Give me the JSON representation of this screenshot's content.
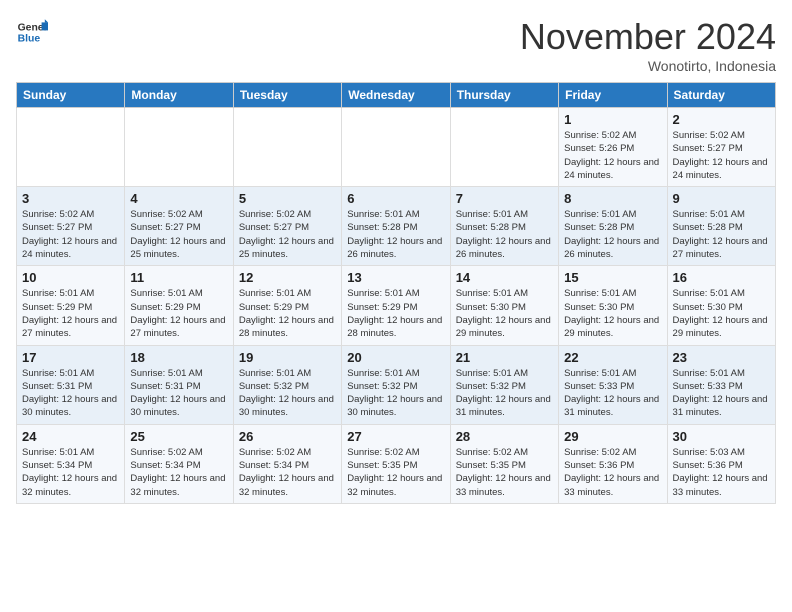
{
  "header": {
    "logo_line1": "General",
    "logo_line2": "Blue",
    "month": "November 2024",
    "location": "Wonotirto, Indonesia"
  },
  "days_of_week": [
    "Sunday",
    "Monday",
    "Tuesday",
    "Wednesday",
    "Thursday",
    "Friday",
    "Saturday"
  ],
  "weeks": [
    [
      {
        "day": "",
        "info": ""
      },
      {
        "day": "",
        "info": ""
      },
      {
        "day": "",
        "info": ""
      },
      {
        "day": "",
        "info": ""
      },
      {
        "day": "",
        "info": ""
      },
      {
        "day": "1",
        "info": "Sunrise: 5:02 AM\nSunset: 5:26 PM\nDaylight: 12 hours and 24 minutes."
      },
      {
        "day": "2",
        "info": "Sunrise: 5:02 AM\nSunset: 5:27 PM\nDaylight: 12 hours and 24 minutes."
      }
    ],
    [
      {
        "day": "3",
        "info": "Sunrise: 5:02 AM\nSunset: 5:27 PM\nDaylight: 12 hours and 24 minutes."
      },
      {
        "day": "4",
        "info": "Sunrise: 5:02 AM\nSunset: 5:27 PM\nDaylight: 12 hours and 25 minutes."
      },
      {
        "day": "5",
        "info": "Sunrise: 5:02 AM\nSunset: 5:27 PM\nDaylight: 12 hours and 25 minutes."
      },
      {
        "day": "6",
        "info": "Sunrise: 5:01 AM\nSunset: 5:28 PM\nDaylight: 12 hours and 26 minutes."
      },
      {
        "day": "7",
        "info": "Sunrise: 5:01 AM\nSunset: 5:28 PM\nDaylight: 12 hours and 26 minutes."
      },
      {
        "day": "8",
        "info": "Sunrise: 5:01 AM\nSunset: 5:28 PM\nDaylight: 12 hours and 26 minutes."
      },
      {
        "day": "9",
        "info": "Sunrise: 5:01 AM\nSunset: 5:28 PM\nDaylight: 12 hours and 27 minutes."
      }
    ],
    [
      {
        "day": "10",
        "info": "Sunrise: 5:01 AM\nSunset: 5:29 PM\nDaylight: 12 hours and 27 minutes."
      },
      {
        "day": "11",
        "info": "Sunrise: 5:01 AM\nSunset: 5:29 PM\nDaylight: 12 hours and 27 minutes."
      },
      {
        "day": "12",
        "info": "Sunrise: 5:01 AM\nSunset: 5:29 PM\nDaylight: 12 hours and 28 minutes."
      },
      {
        "day": "13",
        "info": "Sunrise: 5:01 AM\nSunset: 5:29 PM\nDaylight: 12 hours and 28 minutes."
      },
      {
        "day": "14",
        "info": "Sunrise: 5:01 AM\nSunset: 5:30 PM\nDaylight: 12 hours and 29 minutes."
      },
      {
        "day": "15",
        "info": "Sunrise: 5:01 AM\nSunset: 5:30 PM\nDaylight: 12 hours and 29 minutes."
      },
      {
        "day": "16",
        "info": "Sunrise: 5:01 AM\nSunset: 5:30 PM\nDaylight: 12 hours and 29 minutes."
      }
    ],
    [
      {
        "day": "17",
        "info": "Sunrise: 5:01 AM\nSunset: 5:31 PM\nDaylight: 12 hours and 30 minutes."
      },
      {
        "day": "18",
        "info": "Sunrise: 5:01 AM\nSunset: 5:31 PM\nDaylight: 12 hours and 30 minutes."
      },
      {
        "day": "19",
        "info": "Sunrise: 5:01 AM\nSunset: 5:32 PM\nDaylight: 12 hours and 30 minutes."
      },
      {
        "day": "20",
        "info": "Sunrise: 5:01 AM\nSunset: 5:32 PM\nDaylight: 12 hours and 30 minutes."
      },
      {
        "day": "21",
        "info": "Sunrise: 5:01 AM\nSunset: 5:32 PM\nDaylight: 12 hours and 31 minutes."
      },
      {
        "day": "22",
        "info": "Sunrise: 5:01 AM\nSunset: 5:33 PM\nDaylight: 12 hours and 31 minutes."
      },
      {
        "day": "23",
        "info": "Sunrise: 5:01 AM\nSunset: 5:33 PM\nDaylight: 12 hours and 31 minutes."
      }
    ],
    [
      {
        "day": "24",
        "info": "Sunrise: 5:01 AM\nSunset: 5:34 PM\nDaylight: 12 hours and 32 minutes."
      },
      {
        "day": "25",
        "info": "Sunrise: 5:02 AM\nSunset: 5:34 PM\nDaylight: 12 hours and 32 minutes."
      },
      {
        "day": "26",
        "info": "Sunrise: 5:02 AM\nSunset: 5:34 PM\nDaylight: 12 hours and 32 minutes."
      },
      {
        "day": "27",
        "info": "Sunrise: 5:02 AM\nSunset: 5:35 PM\nDaylight: 12 hours and 32 minutes."
      },
      {
        "day": "28",
        "info": "Sunrise: 5:02 AM\nSunset: 5:35 PM\nDaylight: 12 hours and 33 minutes."
      },
      {
        "day": "29",
        "info": "Sunrise: 5:02 AM\nSunset: 5:36 PM\nDaylight: 12 hours and 33 minutes."
      },
      {
        "day": "30",
        "info": "Sunrise: 5:03 AM\nSunset: 5:36 PM\nDaylight: 12 hours and 33 minutes."
      }
    ]
  ]
}
